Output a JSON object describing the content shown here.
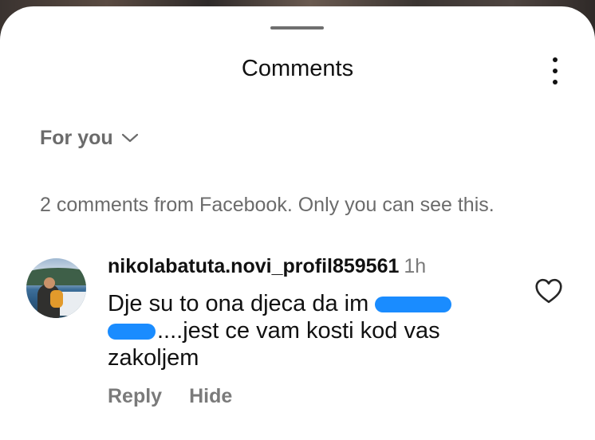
{
  "sheet": {
    "title": "Comments",
    "more_icon": "more-vertical-icon"
  },
  "sort": {
    "label": "For you",
    "icon": "chevron-down-icon"
  },
  "notice": "2 comments from Facebook. Only you can see this.",
  "comment": {
    "username": "nikolabatuta.novi_profil859561",
    "time": "1h",
    "text_line1": "Dje su to ona djeca da im",
    "text_line2": "....jest ce vam kosti kod vas",
    "text_line3": "zakoljem",
    "redaction_color": "#1a8cff",
    "like_icon": "heart-outline-icon",
    "reply_label": "Reply",
    "hide_label": "Hide"
  }
}
